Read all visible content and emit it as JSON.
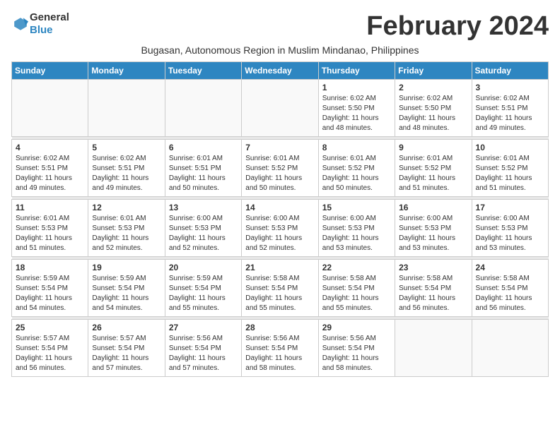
{
  "header": {
    "logo_general": "General",
    "logo_blue": "Blue",
    "month_title": "February 2024",
    "subtitle": "Bugasan, Autonomous Region in Muslim Mindanao, Philippines"
  },
  "days_of_week": [
    "Sunday",
    "Monday",
    "Tuesday",
    "Wednesday",
    "Thursday",
    "Friday",
    "Saturday"
  ],
  "weeks": [
    [
      {
        "day": "",
        "info": ""
      },
      {
        "day": "",
        "info": ""
      },
      {
        "day": "",
        "info": ""
      },
      {
        "day": "",
        "info": ""
      },
      {
        "day": "1",
        "info": "Sunrise: 6:02 AM\nSunset: 5:50 PM\nDaylight: 11 hours\nand 48 minutes."
      },
      {
        "day": "2",
        "info": "Sunrise: 6:02 AM\nSunset: 5:50 PM\nDaylight: 11 hours\nand 48 minutes."
      },
      {
        "day": "3",
        "info": "Sunrise: 6:02 AM\nSunset: 5:51 PM\nDaylight: 11 hours\nand 49 minutes."
      }
    ],
    [
      {
        "day": "4",
        "info": "Sunrise: 6:02 AM\nSunset: 5:51 PM\nDaylight: 11 hours\nand 49 minutes."
      },
      {
        "day": "5",
        "info": "Sunrise: 6:02 AM\nSunset: 5:51 PM\nDaylight: 11 hours\nand 49 minutes."
      },
      {
        "day": "6",
        "info": "Sunrise: 6:01 AM\nSunset: 5:51 PM\nDaylight: 11 hours\nand 50 minutes."
      },
      {
        "day": "7",
        "info": "Sunrise: 6:01 AM\nSunset: 5:52 PM\nDaylight: 11 hours\nand 50 minutes."
      },
      {
        "day": "8",
        "info": "Sunrise: 6:01 AM\nSunset: 5:52 PM\nDaylight: 11 hours\nand 50 minutes."
      },
      {
        "day": "9",
        "info": "Sunrise: 6:01 AM\nSunset: 5:52 PM\nDaylight: 11 hours\nand 51 minutes."
      },
      {
        "day": "10",
        "info": "Sunrise: 6:01 AM\nSunset: 5:52 PM\nDaylight: 11 hours\nand 51 minutes."
      }
    ],
    [
      {
        "day": "11",
        "info": "Sunrise: 6:01 AM\nSunset: 5:53 PM\nDaylight: 11 hours\nand 51 minutes."
      },
      {
        "day": "12",
        "info": "Sunrise: 6:01 AM\nSunset: 5:53 PM\nDaylight: 11 hours\nand 52 minutes."
      },
      {
        "day": "13",
        "info": "Sunrise: 6:00 AM\nSunset: 5:53 PM\nDaylight: 11 hours\nand 52 minutes."
      },
      {
        "day": "14",
        "info": "Sunrise: 6:00 AM\nSunset: 5:53 PM\nDaylight: 11 hours\nand 52 minutes."
      },
      {
        "day": "15",
        "info": "Sunrise: 6:00 AM\nSunset: 5:53 PM\nDaylight: 11 hours\nand 53 minutes."
      },
      {
        "day": "16",
        "info": "Sunrise: 6:00 AM\nSunset: 5:53 PM\nDaylight: 11 hours\nand 53 minutes."
      },
      {
        "day": "17",
        "info": "Sunrise: 6:00 AM\nSunset: 5:53 PM\nDaylight: 11 hours\nand 53 minutes."
      }
    ],
    [
      {
        "day": "18",
        "info": "Sunrise: 5:59 AM\nSunset: 5:54 PM\nDaylight: 11 hours\nand 54 minutes."
      },
      {
        "day": "19",
        "info": "Sunrise: 5:59 AM\nSunset: 5:54 PM\nDaylight: 11 hours\nand 54 minutes."
      },
      {
        "day": "20",
        "info": "Sunrise: 5:59 AM\nSunset: 5:54 PM\nDaylight: 11 hours\nand 55 minutes."
      },
      {
        "day": "21",
        "info": "Sunrise: 5:58 AM\nSunset: 5:54 PM\nDaylight: 11 hours\nand 55 minutes."
      },
      {
        "day": "22",
        "info": "Sunrise: 5:58 AM\nSunset: 5:54 PM\nDaylight: 11 hours\nand 55 minutes."
      },
      {
        "day": "23",
        "info": "Sunrise: 5:58 AM\nSunset: 5:54 PM\nDaylight: 11 hours\nand 56 minutes."
      },
      {
        "day": "24",
        "info": "Sunrise: 5:58 AM\nSunset: 5:54 PM\nDaylight: 11 hours\nand 56 minutes."
      }
    ],
    [
      {
        "day": "25",
        "info": "Sunrise: 5:57 AM\nSunset: 5:54 PM\nDaylight: 11 hours\nand 56 minutes."
      },
      {
        "day": "26",
        "info": "Sunrise: 5:57 AM\nSunset: 5:54 PM\nDaylight: 11 hours\nand 57 minutes."
      },
      {
        "day": "27",
        "info": "Sunrise: 5:56 AM\nSunset: 5:54 PM\nDaylight: 11 hours\nand 57 minutes."
      },
      {
        "day": "28",
        "info": "Sunrise: 5:56 AM\nSunset: 5:54 PM\nDaylight: 11 hours\nand 58 minutes."
      },
      {
        "day": "29",
        "info": "Sunrise: 5:56 AM\nSunset: 5:54 PM\nDaylight: 11 hours\nand 58 minutes."
      },
      {
        "day": "",
        "info": ""
      },
      {
        "day": "",
        "info": ""
      }
    ]
  ]
}
